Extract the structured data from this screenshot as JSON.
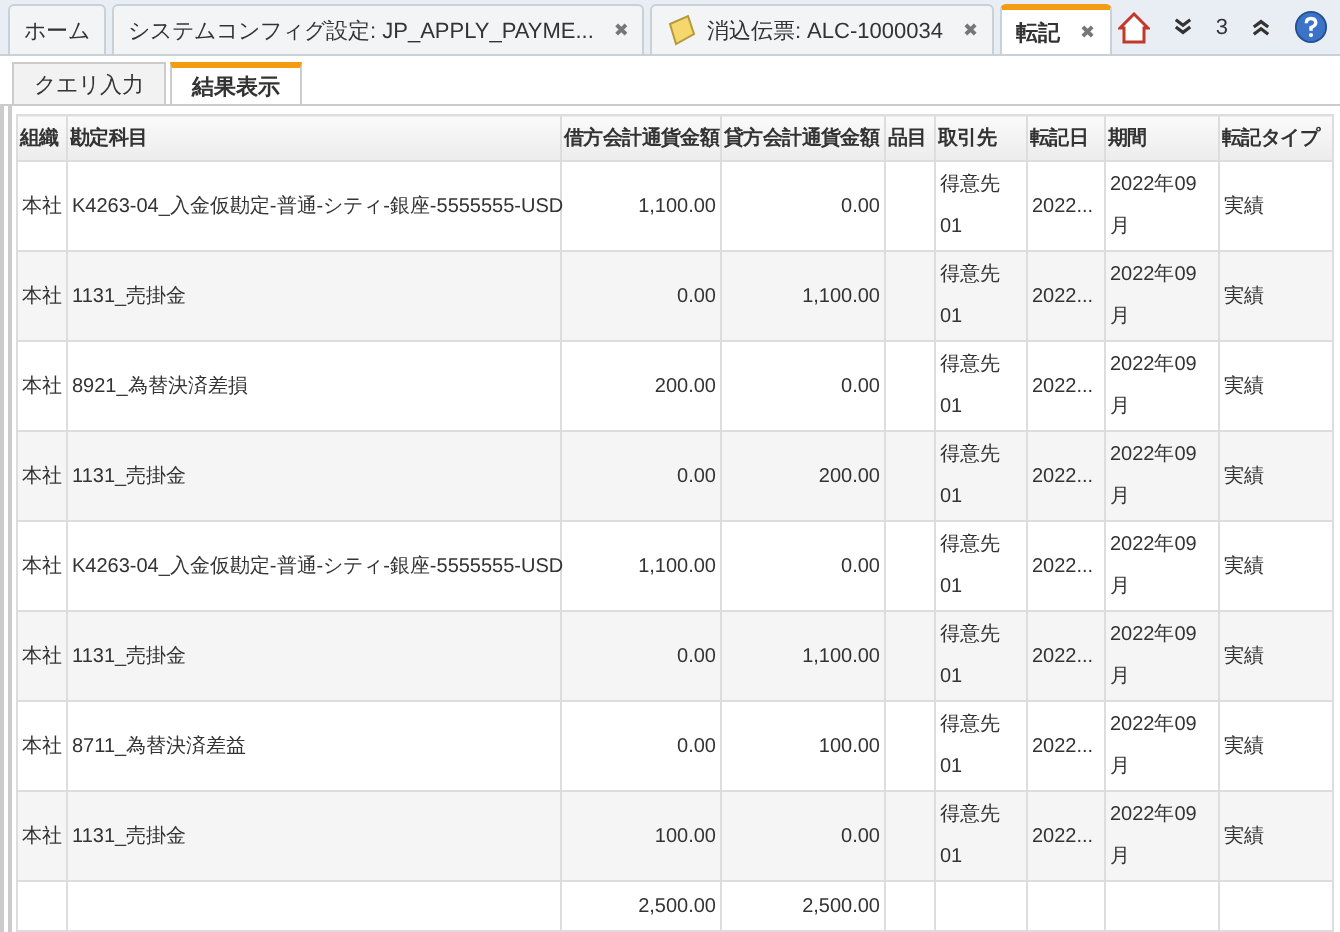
{
  "tabs": [
    {
      "label": "ホーム",
      "selected": false,
      "closable": false,
      "kind": "plain"
    },
    {
      "label": "システムコンフィグ設定: JP_APPLY_PAYME...",
      "selected": false,
      "closable": true,
      "kind": "plain"
    },
    {
      "label": "消込伝票: ALC-1000034",
      "selected": false,
      "closable": true,
      "kind": "document"
    },
    {
      "label": "転記",
      "selected": true,
      "closable": true,
      "kind": "plain"
    }
  ],
  "tab_close": "✖",
  "toolbar": {
    "count": "3"
  },
  "subtabs": [
    {
      "label": "クエリ入力",
      "selected": false
    },
    {
      "label": "結果表示",
      "selected": true
    }
  ],
  "table": {
    "columns": [
      "組織",
      "勘定科目",
      "借方会計通貨金額",
      "貸方会計通貨金額",
      "品目",
      "取引先",
      "転記日",
      "期間",
      "転記タイプ"
    ],
    "rows": [
      [
        "本社",
        "K4263-04_入金仮勘定-普通-シティ-銀座-5555555-USD",
        "1,100.00",
        "0.00",
        "",
        "得意先01",
        "2022...",
        "2022年09月",
        "実績"
      ],
      [
        "本社",
        "1131_売掛金",
        "0.00",
        "1,100.00",
        "",
        "得意先01",
        "2022...",
        "2022年09月",
        "実績"
      ],
      [
        "本社",
        "8921_為替決済差損",
        "200.00",
        "0.00",
        "",
        "得意先01",
        "2022...",
        "2022年09月",
        "実績"
      ],
      [
        "本社",
        "1131_売掛金",
        "0.00",
        "200.00",
        "",
        "得意先01",
        "2022...",
        "2022年09月",
        "実績"
      ],
      [
        "本社",
        "K4263-04_入金仮勘定-普通-シティ-銀座-5555555-USD",
        "1,100.00",
        "0.00",
        "",
        "得意先01",
        "2022...",
        "2022年09月",
        "実績"
      ],
      [
        "本社",
        "1131_売掛金",
        "0.00",
        "1,100.00",
        "",
        "得意先01",
        "2022...",
        "2022年09月",
        "実績"
      ],
      [
        "本社",
        "8711_為替決済差益",
        "0.00",
        "100.00",
        "",
        "得意先01",
        "2022...",
        "2022年09月",
        "実績"
      ],
      [
        "本社",
        "1131_売掛金",
        "100.00",
        "0.00",
        "",
        "得意先01",
        "2022...",
        "2022年09月",
        "実績"
      ]
    ],
    "totals": {
      "debit": "2,500.00",
      "credit": "2,500.00"
    }
  }
}
